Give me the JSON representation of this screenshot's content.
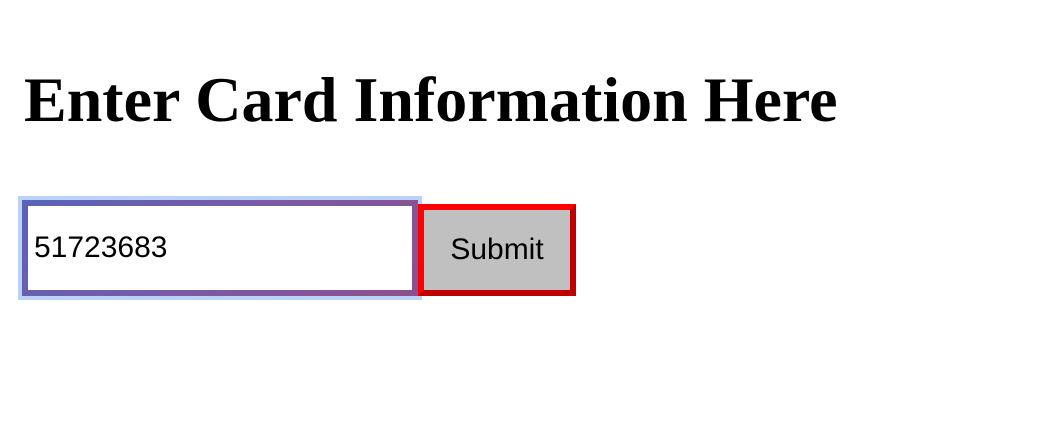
{
  "header": {
    "title": "Enter Card Information Here"
  },
  "form": {
    "card_input": {
      "value": "51723683",
      "placeholder": ""
    },
    "submit_label": "Submit"
  },
  "colors": {
    "input_border": "#6a5ba9",
    "focus_ring": "#b9d2f5",
    "button_border": "#e00000",
    "button_background": "#c0c0c0"
  }
}
